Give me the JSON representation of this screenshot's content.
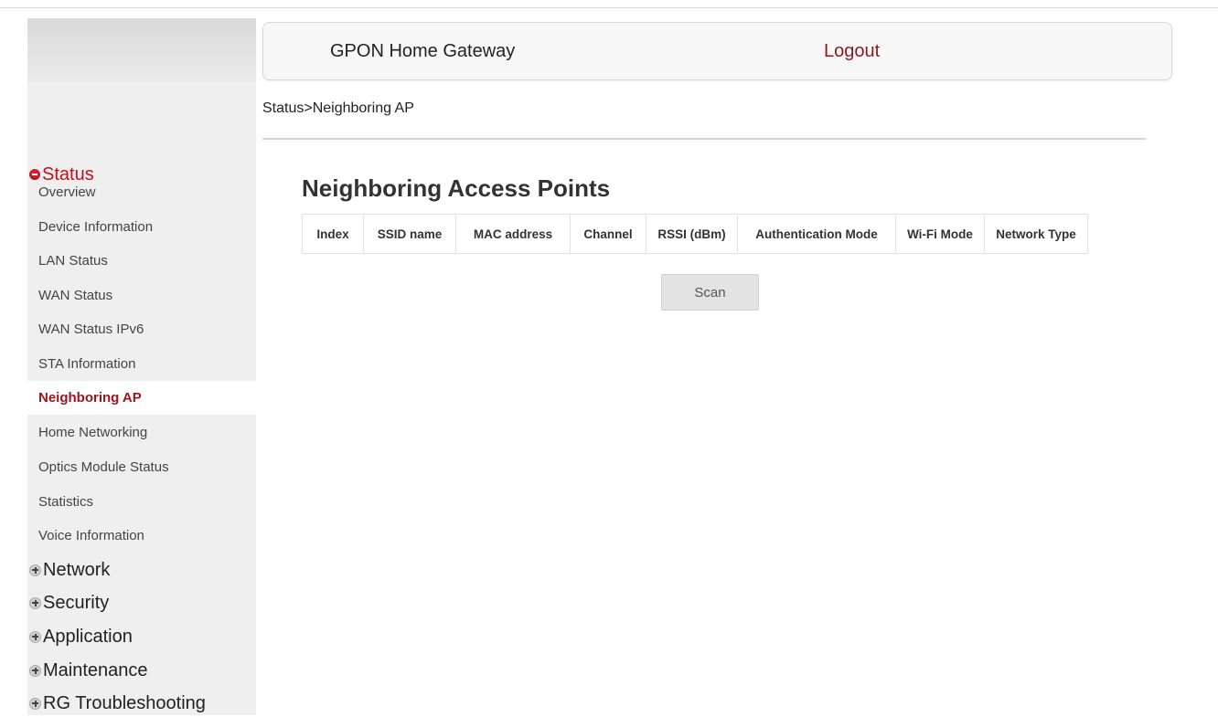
{
  "header": {
    "title": "GPON Home Gateway",
    "logout_label": "Logout"
  },
  "breadcrumb": "Status>Neighboring AP",
  "page_title": "Neighboring Access Points",
  "table": {
    "columns": [
      "Index",
      "SSID name",
      "MAC address",
      "Channel",
      "RSSI (dBm)",
      "Authentication Mode",
      "Wi-Fi Mode",
      "Network Type"
    ],
    "rows": []
  },
  "scan_label": "Scan",
  "sidebar": {
    "status": {
      "label": "Status",
      "expanded": true,
      "items": [
        "Overview",
        "Device Information",
        "LAN Status",
        "WAN Status",
        "WAN Status IPv6",
        "STA Information",
        "Neighboring AP",
        "Home Networking",
        "Optics Module Status",
        "Statistics",
        "Voice Information"
      ],
      "selected": "Neighboring AP"
    },
    "groups": [
      "Network",
      "Security",
      "Application",
      "Maintenance",
      "RG Troubleshooting"
    ]
  },
  "colors": {
    "accent_red": "#c0101e",
    "selected_text": "#a0141e",
    "logout": "#8b1a1a"
  }
}
